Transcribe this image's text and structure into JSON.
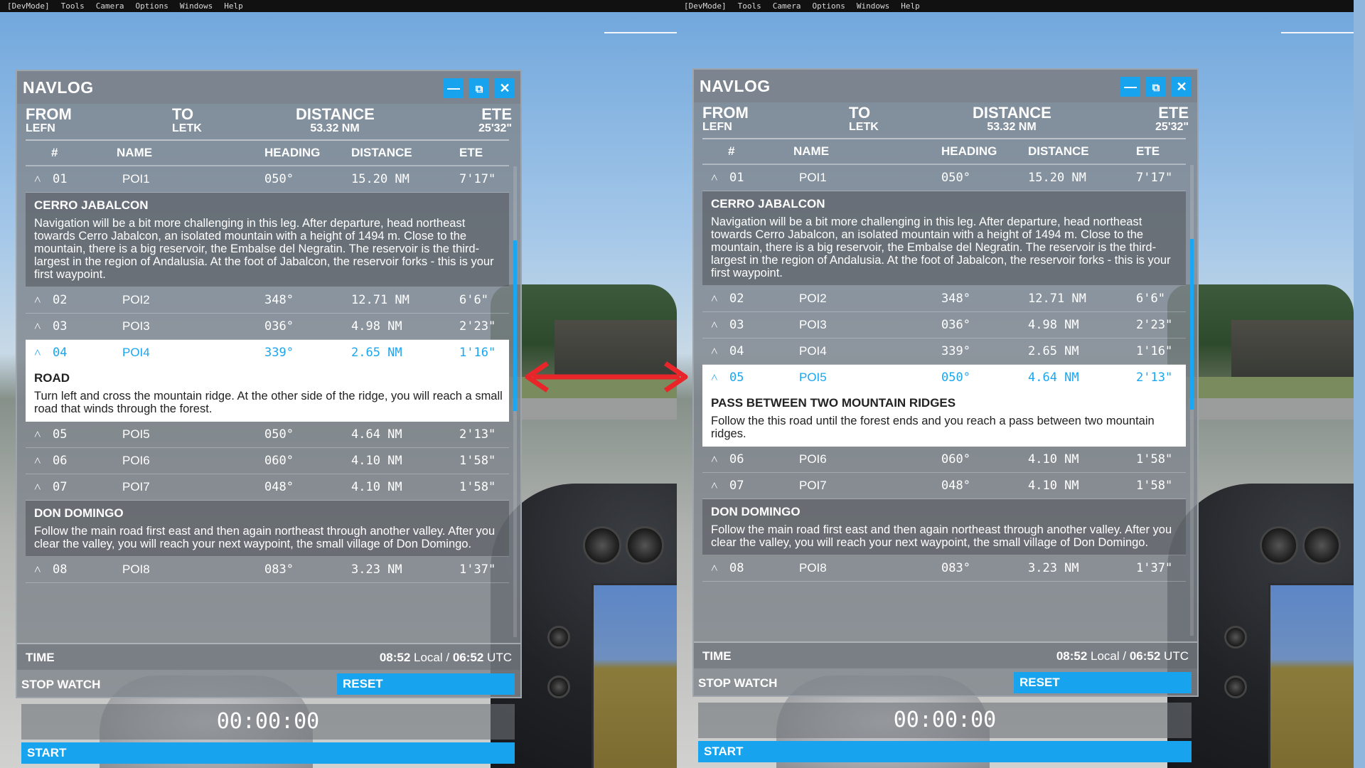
{
  "menu": [
    "[DevMode]",
    "Tools",
    "Camera",
    "Options",
    "Windows",
    "Help"
  ],
  "panels": [
    {
      "title": "NAVLOG",
      "route": {
        "from_label": "FROM",
        "from_value": "LEFN",
        "to_label": "TO",
        "to_value": "LETK",
        "distance_label": "DISTANCE",
        "distance_value": "53.32 NM",
        "ete_label": "ETE",
        "ete_value": "25'32\""
      },
      "columns": [
        "#",
        "NAME",
        "HEADING",
        "DISTANCE",
        "ETE"
      ],
      "rows": [
        {
          "num": "01",
          "name": "POI1",
          "heading": "050°",
          "distance": "15.20 NM",
          "ete": "7'17\""
        },
        {
          "num": "02",
          "name": "POI2",
          "heading": "348°",
          "distance": "12.71 NM",
          "ete": "6'6\""
        },
        {
          "num": "03",
          "name": "POI3",
          "heading": "036°",
          "distance": "4.98 NM",
          "ete": "2'23\""
        },
        {
          "num": "04",
          "name": "POI4",
          "heading": "339°",
          "distance": "2.65 NM",
          "ete": "1'16\""
        },
        {
          "num": "05",
          "name": "POI5",
          "heading": "050°",
          "distance": "4.64 NM",
          "ete": "2'13\""
        },
        {
          "num": "06",
          "name": "POI6",
          "heading": "060°",
          "distance": "4.10 NM",
          "ete": "1'58\""
        },
        {
          "num": "07",
          "name": "POI7",
          "heading": "048°",
          "distance": "4.10 NM",
          "ete": "1'58\""
        },
        {
          "num": "08",
          "name": "POI8",
          "heading": "083°",
          "distance": "3.23 NM",
          "ete": "1'37\""
        }
      ],
      "descriptions": [
        {
          "title": "CERRO JABALCON",
          "text": "Navigation will be a bit more challenging in this leg. After departure, head northeast towards Cerro Jabalcon, an isolated mountain with a height of 1494 m. Close to the mountain, there is a big reservoir, the Embalse del Negratin. The reservoir is the third-largest in the region of Andalusia. At the foot of Jabalcon, the reservoir forks - this is your first waypoint."
        },
        {
          "title": "ROAD",
          "text": "Turn left and cross the mountain ridge. At the other side of the ridge, you will reach a small road that winds through the forest."
        },
        {
          "title": "DON DOMINGO",
          "text": "Follow the main road first east and then again northeast through another valley. After you clear the valley, you will reach your next waypoint, the small village of Don Domingo."
        }
      ],
      "time_label": "TIME",
      "time_local": "08:52",
      "time_local_suffix": " Local / ",
      "time_utc": "06:52",
      "time_utc_suffix": " UTC",
      "stopwatch_label": "STOP WATCH",
      "reset_label": "RESET",
      "stopwatch_value": "00:00:00",
      "start_label": "START"
    },
    {
      "title": "NAVLOG",
      "route": {
        "from_label": "FROM",
        "from_value": "LEFN",
        "to_label": "TO",
        "to_value": "LETK",
        "distance_label": "DISTANCE",
        "distance_value": "53.32 NM",
        "ete_label": "ETE",
        "ete_value": "25'32\""
      },
      "columns": [
        "#",
        "NAME",
        "HEADING",
        "DISTANCE",
        "ETE"
      ],
      "rows": [
        {
          "num": "01",
          "name": "POI1",
          "heading": "050°",
          "distance": "15.20 NM",
          "ete": "7'17\""
        },
        {
          "num": "02",
          "name": "POI2",
          "heading": "348°",
          "distance": "12.71 NM",
          "ete": "6'6\""
        },
        {
          "num": "03",
          "name": "POI3",
          "heading": "036°",
          "distance": "4.98 NM",
          "ete": "2'23\""
        },
        {
          "num": "04",
          "name": "POI4",
          "heading": "339°",
          "distance": "2.65 NM",
          "ete": "1'16\""
        },
        {
          "num": "05",
          "name": "POI5",
          "heading": "050°",
          "distance": "4.64 NM",
          "ete": "2'13\""
        },
        {
          "num": "06",
          "name": "POI6",
          "heading": "060°",
          "distance": "4.10 NM",
          "ete": "1'58\""
        },
        {
          "num": "07",
          "name": "POI7",
          "heading": "048°",
          "distance": "4.10 NM",
          "ete": "1'58\""
        },
        {
          "num": "08",
          "name": "POI8",
          "heading": "083°",
          "distance": "3.23 NM",
          "ete": "1'37\""
        }
      ],
      "descriptions": [
        {
          "title": "CERRO JABALCON",
          "text": "Navigation will be a bit more challenging in this leg. After departure, head northeast towards Cerro Jabalcon, an isolated mountain with a height of 1494 m. Close to the mountain, there is a big reservoir, the Embalse del Negratin. The reservoir is the third-largest in the region of Andalusia. At the foot of Jabalcon, the reservoir forks - this is your first waypoint."
        },
        {
          "title": "PASS BETWEEN TWO MOUNTAIN RIDGES",
          "text": "Follow the this road until the forest ends and you reach a pass between two mountain ridges."
        },
        {
          "title": "DON DOMINGO",
          "text": "Follow the main road first east and then again northeast through another valley. After you clear the valley, you will reach your next waypoint, the small village of Don Domingo."
        }
      ],
      "time_label": "TIME",
      "time_local": "08:52",
      "time_local_suffix": " Local / ",
      "time_utc": "06:52",
      "time_utc_suffix": " UTC",
      "stopwatch_label": "STOP WATCH",
      "reset_label": "RESET",
      "stopwatch_value": "00:00:00",
      "start_label": "START"
    }
  ],
  "colors": {
    "accent": "#18a3ee",
    "arrow": "#e8262a",
    "panel_bg": "#80868d"
  },
  "icons": {
    "minimize": "minimize-icon",
    "popout": "popout-icon",
    "close": "close-icon",
    "expand": "chevron-up-icon",
    "arrow": "double-arrow-icon"
  }
}
